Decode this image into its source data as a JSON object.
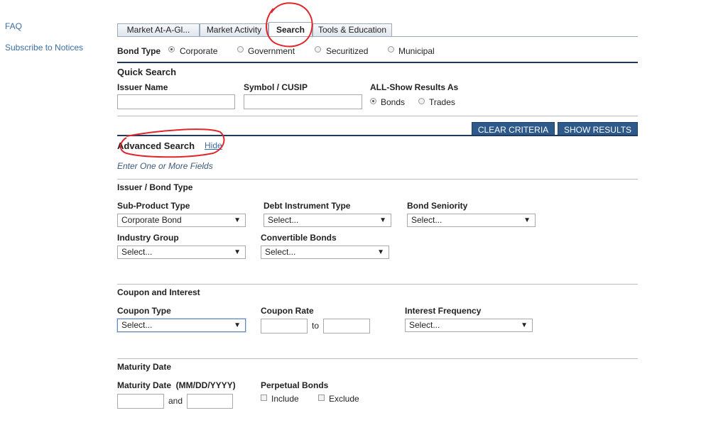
{
  "sidebar": {
    "faq": "FAQ",
    "subscribe": "Subscribe to Notices"
  },
  "tabs": [
    "Market At-A-Gl...",
    "Market Activity",
    "Search",
    "Tools & Education"
  ],
  "bond_type": {
    "label": "Bond Type",
    "options": [
      "Corporate",
      "Government",
      "Securitized",
      "Municipal"
    ],
    "selected": "Corporate"
  },
  "quick_search": {
    "title": "Quick Search",
    "issuer_label": "Issuer Name",
    "symbol_label": "Symbol / CUSIP",
    "show_as_label": "ALL-Show Results As",
    "show_options": [
      "Bonds",
      "Trades"
    ],
    "show_selected": "Bonds"
  },
  "buttons": {
    "clear": "CLEAR CRITERIA",
    "show": "SHOW RESULTS"
  },
  "advanced": {
    "title": "Advanced Search",
    "hide": "Hide",
    "hint": "Enter One or More Fields"
  },
  "issuer_section": {
    "title": "Issuer / Bond Type",
    "sub_product_label": "Sub-Product Type",
    "sub_product_value": "Corporate Bond",
    "debt_label": "Debt Instrument Type",
    "debt_value": "Select...",
    "seniority_label": "Bond Seniority",
    "seniority_value": "Select...",
    "industry_label": "Industry Group",
    "industry_value": "Select...",
    "convertible_label": "Convertible Bonds",
    "convertible_value": "Select..."
  },
  "coupon_section": {
    "title": "Coupon and Interest",
    "type_label": "Coupon Type",
    "type_value": "Select...",
    "rate_label": "Coupon Rate",
    "rate_to": "to",
    "freq_label": "Interest Frequency",
    "freq_value": "Select..."
  },
  "maturity_section": {
    "title": "Maturity Date",
    "date_label": "Maturity Date  (MM/DD/YYYY)",
    "and": "and",
    "perpetual_label": "Perpetual Bonds",
    "include": "Include",
    "exclude": "Exclude"
  },
  "annotation_color": "#e0262b"
}
